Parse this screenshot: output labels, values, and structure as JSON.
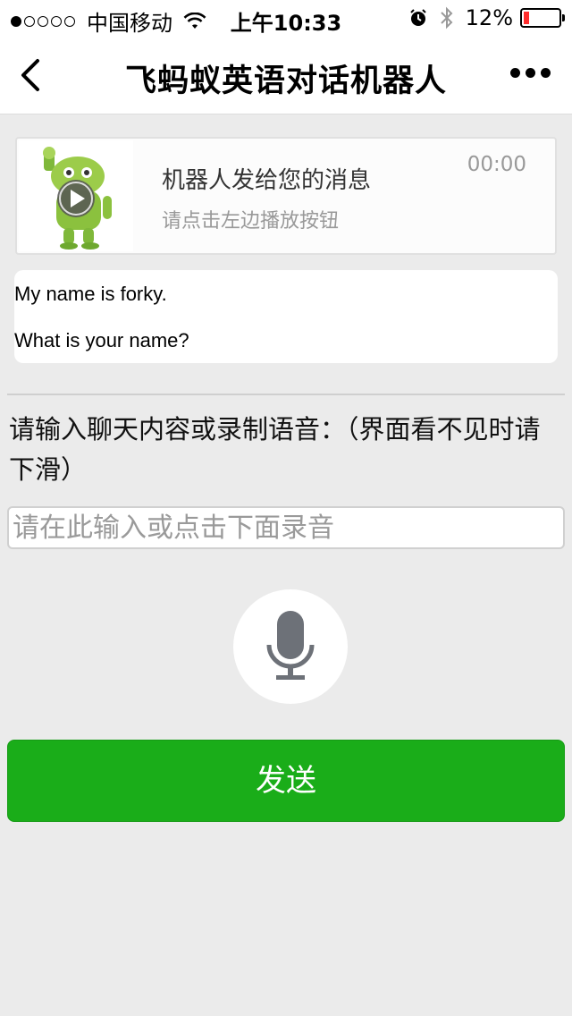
{
  "status_bar": {
    "carrier": "中国移动",
    "time": "上午10:33",
    "battery": "12%",
    "battery_level": 0.12
  },
  "nav": {
    "title": "飞蚂蚁英语对话机器人"
  },
  "audio_card": {
    "title": "机器人发给您的消息",
    "subtitle": "请点击左边播放按钮",
    "duration": "00:00"
  },
  "message": {
    "lines": [
      "My name is forky.",
      "What is your name?"
    ]
  },
  "prompt": {
    "label": "请输入聊天内容或录制语音：（界面看不见时请下滑）"
  },
  "chat_input": {
    "placeholder": "请在此输入或点击下面录音",
    "value": ""
  },
  "send": {
    "label": "发送"
  },
  "colors": {
    "accent": "#1aad19",
    "background": "#ebebeb"
  },
  "icons": [
    "back-icon",
    "more-icon",
    "wifi-icon",
    "alarm-icon",
    "bluetooth-icon",
    "play-icon",
    "microphone-icon"
  ]
}
